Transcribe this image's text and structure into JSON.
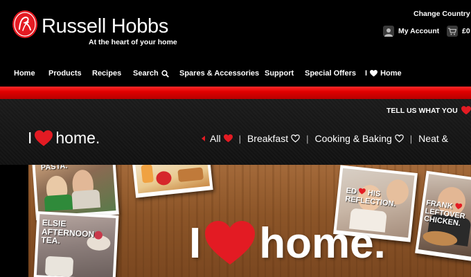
{
  "header": {
    "brand": "Russell Hobbs",
    "tagline": "At the heart of your home",
    "change_country": "Change Country & I",
    "account_label": "My Account",
    "cart_amount": "£0"
  },
  "nav": {
    "items": [
      {
        "label": "Home"
      },
      {
        "label": "Products"
      },
      {
        "label": "Recipes"
      },
      {
        "label": "Search"
      },
      {
        "label": "Spares & Accessories"
      },
      {
        "label": "Support"
      },
      {
        "label": "Special Offers"
      },
      {
        "label_pre": "I",
        "label_post": "Home"
      }
    ]
  },
  "band": {
    "tell_us": "TELL US WHAT YOU",
    "logo_pre": "I",
    "logo_post": "home."
  },
  "filters": [
    {
      "label": "All"
    },
    {
      "label": "Breakfast"
    },
    {
      "label": "Cooking & Baking"
    },
    {
      "label": "Neat &"
    }
  ],
  "hero": {
    "title_pre": "I",
    "title_post": "home.",
    "photos": [
      {
        "caption": "PASTA."
      },
      {
        "caption": "ELSIE AFTERNOON TEA."
      },
      {
        "caption_pre": "ED",
        "caption_post": "HIS REFLECTION."
      },
      {
        "caption_pre": "FRANK",
        "caption_post": "LEFTOVER CHICKEN."
      }
    ]
  },
  "colors": {
    "brand_red": "#e31b23",
    "background": "#000000"
  }
}
